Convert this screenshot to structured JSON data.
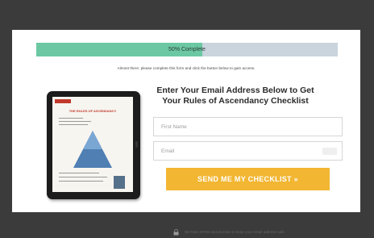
{
  "progress": {
    "label": "50% Complete",
    "percent": 55
  },
  "notice": "Almost there: please complete this form and click the button below to gain access.",
  "tablet": {
    "doc_title": "THE RULES OF ASCENDANCY",
    "icon": "ebook-cover-image"
  },
  "form": {
    "headline": "Enter Your Email Address Below to Get Your Rules of Ascendancy Checklist",
    "first_name_placeholder": "First Name",
    "email_placeholder": "Email",
    "submit_label": "SEND ME MY CHECKLIST »"
  },
  "privacy": {
    "text": "We hate SPAM and promise to keep your email address safe",
    "icon": "lock-icon"
  },
  "colors": {
    "overlay": "#3b3b3b",
    "progress_track": "#c9d4dd",
    "progress_fill": "#6bc8a2",
    "cta": "#f2b632",
    "accent_red": "#c0392b"
  }
}
